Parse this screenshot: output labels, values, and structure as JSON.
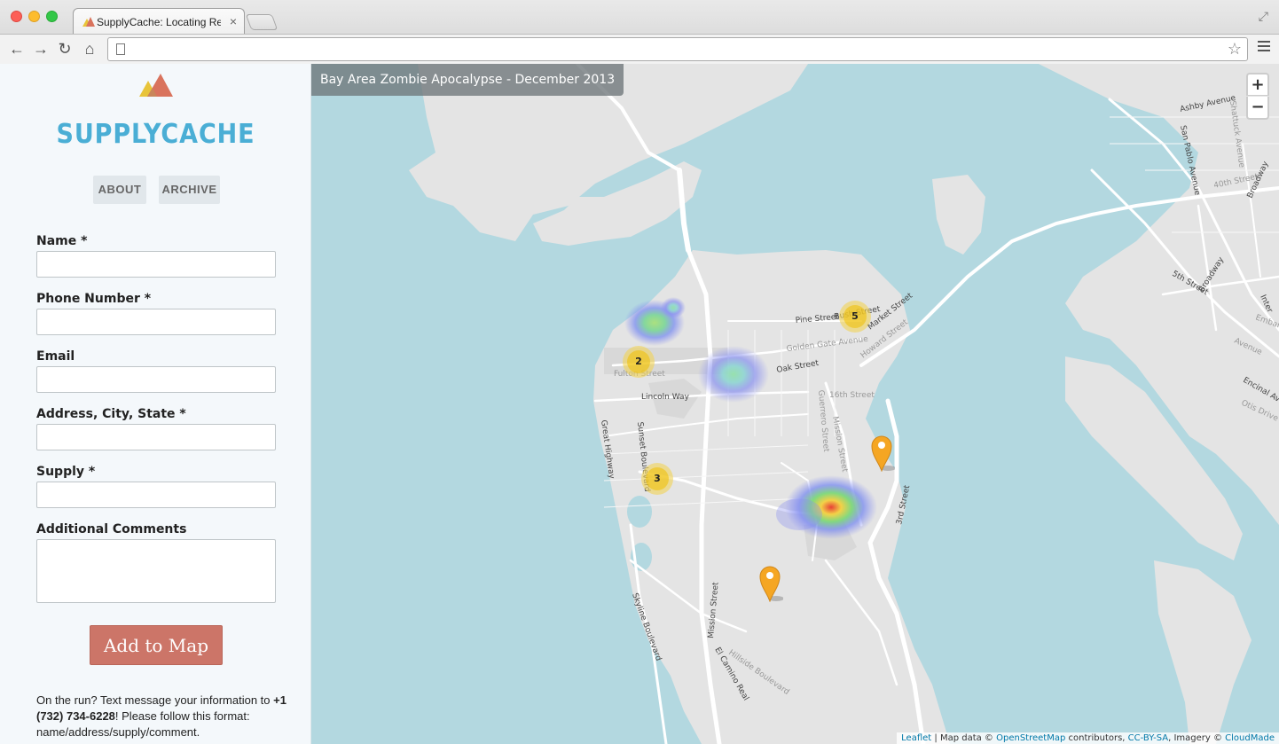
{
  "browser": {
    "tab_title": "SupplyCache: Locating Res",
    "tab_close": "×"
  },
  "sidebar": {
    "brand": "SUPPLYCACHE",
    "nav": [
      "ABOUT",
      "ARCHIVE"
    ],
    "form": {
      "fields": [
        {
          "label": "Name *",
          "value": ""
        },
        {
          "label": "Phone Number *",
          "value": ""
        },
        {
          "label": "Email",
          "value": ""
        },
        {
          "label": "Address, City, State *",
          "value": ""
        },
        {
          "label": "Supply *",
          "value": ""
        },
        {
          "label": "Additional Comments",
          "value": ""
        }
      ],
      "submit_label": "Add to Map"
    },
    "sms_note": {
      "prefix": "On the run? Text message your information to",
      "phone": "+1 (732) 734-6228",
      "suffix": "! Please follow this format: name/address/supply/comment."
    }
  },
  "map": {
    "title": "Bay Area Zombie Apocalypse - December 2013",
    "zoom_in": "+",
    "zoom_out": "−",
    "attribution": {
      "leaflet": "Leaflet",
      "sep1": " | Map data © ",
      "osm": "OpenStreetMap",
      "sep2": " contributors, ",
      "license": "CC-BY-SA",
      "sep3": ", Imagery © ",
      "imagery": "CloudMade"
    },
    "clusters": [
      {
        "count": "5"
      },
      {
        "count": "2"
      },
      {
        "count": "3"
      }
    ],
    "streets": {
      "pine": "Pine Street",
      "bush": "Bush Street",
      "market": "Market Street",
      "golden_gate": "Golden Gate Avenue",
      "howard": "Howard Street",
      "oak": "Oak Street",
      "fulton": "Fulton Street",
      "lincoln": "Lincoln Way",
      "sixteenth": "16th Street",
      "guerrero": "Guerrero Street",
      "mission": "Mission Street",
      "great_highway": "Great Highway",
      "sunset": "Sunset Boulevard",
      "third": "3rd Street",
      "skyline": "Skyline Boulevard",
      "mission2": "Mission Street",
      "el_camino": "El Camino Real",
      "hillside": "Hillside Boulevard",
      "ashby": "Ashby Avenue",
      "san_pablo": "San Pablo Avenue",
      "shattuck": "Shattuck Avenue",
      "fortieth": "40th Street",
      "broadway": "Broadway",
      "fifth": "5th Street",
      "broadway2": "Broadway",
      "encinal": "Encinal Ave",
      "otis": "Otis Drive",
      "embarcadero": "Embarc",
      "interstate": "Inter",
      "avenue": "Avenue"
    },
    "colors": {
      "water": "#b3d8e0",
      "land": "#e4e4e4",
      "road": "#ffffff",
      "park": "#d6d6d6",
      "cluster_outer": "#f1d357",
      "cluster_inner": "#f0c20c",
      "marker": "#f5a623"
    }
  }
}
